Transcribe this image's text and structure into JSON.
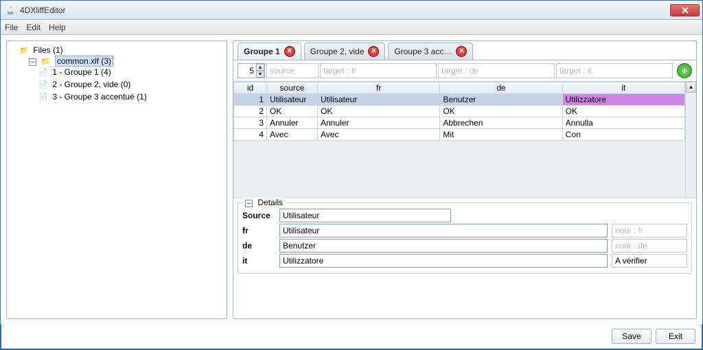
{
  "window": {
    "title": "4DXliffEditor"
  },
  "menu": {
    "file": "File",
    "edit": "Edit",
    "help": "Help"
  },
  "tree": {
    "root": "Files (1)",
    "file": "common.xlf (3)",
    "groups": [
      "1 - Groupe 1 (4)",
      "2 - Groupe 2, vide (0)",
      "3 - Groupe 3 accentué (1)"
    ]
  },
  "tabs": [
    {
      "label": "Groupe 1",
      "active": true
    },
    {
      "label": "Groupe 2, vide",
      "active": false
    },
    {
      "label": "Groupe 3 acc…",
      "active": false
    }
  ],
  "search": {
    "page": "5",
    "placeholders": {
      "source": "source",
      "fr": "target : fr",
      "de": "target : de",
      "it": "target : it"
    }
  },
  "columns": {
    "id": "id",
    "source": "source",
    "fr": "fr",
    "de": "de",
    "it": "it"
  },
  "rows": [
    {
      "id": "1",
      "source": "Utilisateur",
      "fr": "Utilisateur",
      "de": "Benutzer",
      "it": "Utilizzatore",
      "selected": true
    },
    {
      "id": "2",
      "source": "OK",
      "fr": "OK",
      "de": "OK",
      "it": "OK"
    },
    {
      "id": "3",
      "source": "Annuler",
      "fr": "Annuler",
      "de": "Abbrechen",
      "it": "Annulla"
    },
    {
      "id": "4",
      "source": "Avec",
      "fr": "Avec",
      "de": "Mit",
      "it": "Con"
    }
  ],
  "details": {
    "title": "Details",
    "labels": {
      "source": "Source",
      "fr": "fr",
      "de": "de",
      "it": "it"
    },
    "values": {
      "source": "Utilisateur",
      "fr": "Utilisateur",
      "de": "Benutzer",
      "it": "Utilizzatore"
    },
    "notes": {
      "fr_ph": "note : fr",
      "de_ph": "note : de",
      "it_val": "A vérifier"
    }
  },
  "footer": {
    "save": "Save",
    "exit": "Exit"
  }
}
